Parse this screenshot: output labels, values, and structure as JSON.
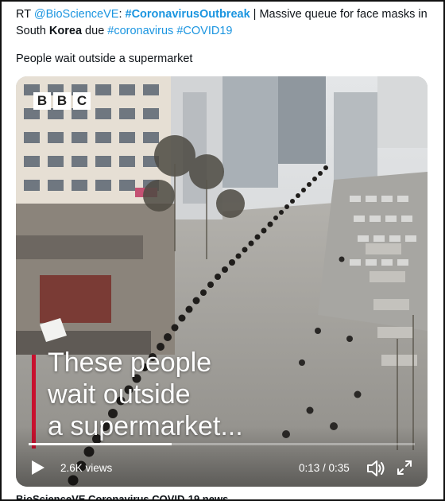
{
  "tweet": {
    "rt_prefix": "RT ",
    "mention": "@BioScienceVE",
    "colon": ": ",
    "hashtag_outbreak": "#CoronavirusOutbreak",
    "text_part1": " | Massive queue for face masks in South ",
    "korea": "Korea",
    "text_part2": " due ",
    "hashtag_coronavirus": "#coronavirus",
    "space": " ",
    "hashtag_covid": "#COVID19",
    "caption": "People wait outside a supermarket"
  },
  "video": {
    "logo_letters": [
      "B",
      "B",
      "C"
    ],
    "overlay_lines": [
      "These people",
      "wait outside",
      "a supermarket..."
    ],
    "views": "2.6K views",
    "time": "0:13 / 0:35",
    "progress_fraction": 0.37,
    "accent_color": "#c8102e",
    "icons": [
      "play-icon",
      "volume-icon",
      "fullscreen-icon"
    ]
  },
  "footer_peek": "BioScienceVE Coronavirus COVID-19 news"
}
